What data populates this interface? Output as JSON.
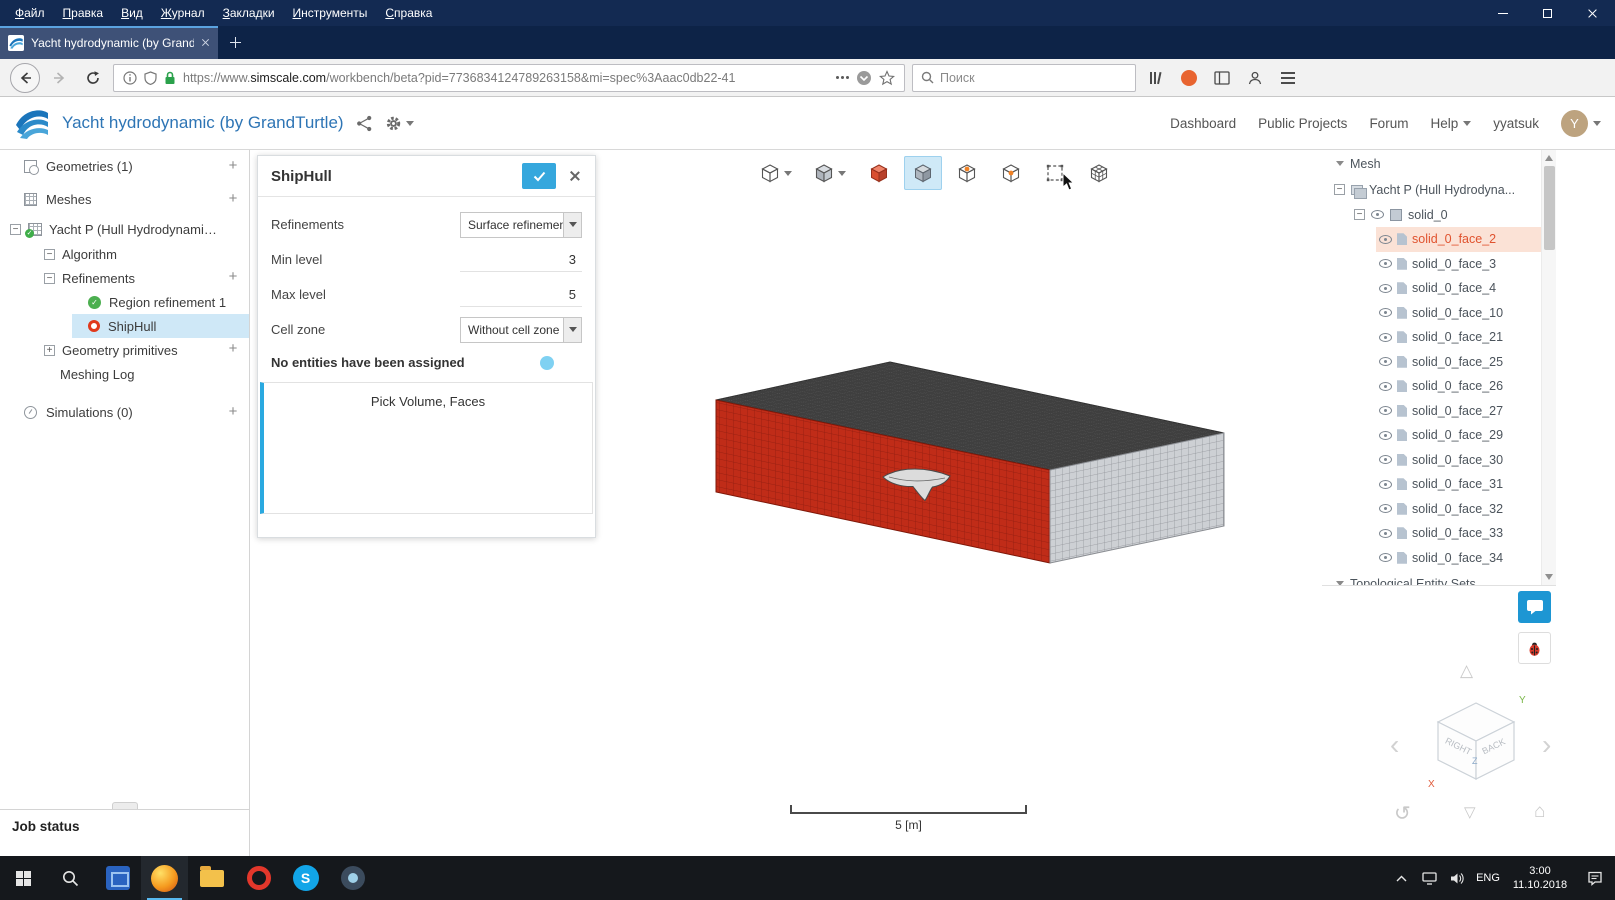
{
  "browser": {
    "menu": [
      "Файл",
      "Правка",
      "Вид",
      "Журнал",
      "Закладки",
      "Инструменты",
      "Справка"
    ],
    "tab_title": "Yacht hydrodynamic (by Grand",
    "url_prefix": "https://www.",
    "url_domain": "simscale.com",
    "url_path": "/workbench/beta?pid=7736834124789263158&mi=spec%3Aaac0db22-41",
    "search_placeholder": "Поиск"
  },
  "header": {
    "title": "Yacht hydrodynamic (by GrandTurtle)",
    "links": [
      "Dashboard",
      "Public Projects",
      "Forum",
      "Help"
    ],
    "user": "yyatsuk",
    "avatar_letter": "Y"
  },
  "tree": {
    "geometries": "Geometries (1)",
    "meshes": "Meshes",
    "mesh_item": "Yacht P (Hull Hydrodynamics) m...",
    "algorithm": "Algorithm",
    "refinements": "Refinements",
    "region": "Region refinement 1",
    "shiphull": "ShipHull",
    "geometry_primitives": "Geometry primitives",
    "meshing_log": "Meshing Log",
    "simulations": "Simulations (0)",
    "job_status": "Job status"
  },
  "panel": {
    "title": "ShipHull",
    "f1_label": "Refinements",
    "f1_value": "Surface refinement",
    "f2_label": "Min level",
    "f2_value": "3",
    "f3_label": "Max level",
    "f3_value": "5",
    "f4_label": "Cell zone",
    "f4_value": "Without cell zone",
    "note": "No entities have been assigned",
    "pick": "Pick Volume, Faces"
  },
  "viewport": {
    "scale_label": "5 [m]"
  },
  "rtree": {
    "root": "Mesh",
    "item": "Yacht P (Hull Hydrodyna...",
    "solid": "solid_0",
    "faces": [
      "solid_0_face_2",
      "solid_0_face_3",
      "solid_0_face_4",
      "solid_0_face_10",
      "solid_0_face_21",
      "solid_0_face_25",
      "solid_0_face_26",
      "solid_0_face_27",
      "solid_0_face_29",
      "solid_0_face_30",
      "solid_0_face_31",
      "solid_0_face_32",
      "solid_0_face_33",
      "solid_0_face_34"
    ],
    "selected_face": "solid_0_face_2",
    "footer": "Topological Entity Sets"
  },
  "navcube": {
    "right": "RIGHT",
    "back": "BACK",
    "x": "X",
    "y": "Y",
    "z": "Z"
  },
  "taskbar": {
    "lang": "ENG",
    "time": "3:00",
    "date": "11.10.2018",
    "skype_letter": "S"
  },
  "colors": {
    "titlebar_navy": "#132a52",
    "accent_blue": "#2aa9e0",
    "selection_blue": "#cfe8f7",
    "selected_face_text": "#e0532f",
    "mesh_red": "#c02c18"
  }
}
